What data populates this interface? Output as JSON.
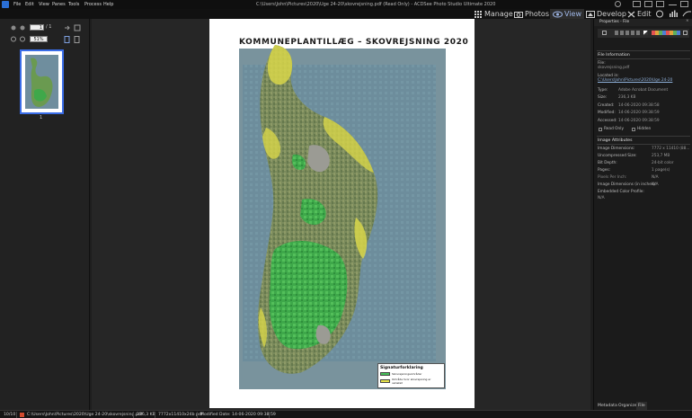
{
  "menubar": {
    "items": [
      "File",
      "Edit",
      "View",
      "Panes",
      "Tools",
      "Process",
      "Help"
    ]
  },
  "window_title": "C:\\Users\\John\\Pictures\\2020\\Uge 24-20\\skovrejsning.pdf (Read Only) - ACDSee Photo Studio Ultimate 2020",
  "modes": [
    "Manage",
    "Photos",
    "View",
    "Develop",
    "Edit"
  ],
  "active_mode": "View",
  "left_toolbar": {
    "page_current": "1",
    "page_total": "/ 1",
    "zoom": "51%"
  },
  "thumbnails": [
    {
      "page_number": "1"
    }
  ],
  "document": {
    "title": "KOMMUNEPLANTILLÆG – SKOVREJSNING 2020",
    "legend_title": "Signaturforklaring",
    "legend_items": [
      {
        "label": "Skovrejsningsområder",
        "color": "#46c15a"
      },
      {
        "label": "Område hvor skovrejsning er uønsket",
        "color": "#e6e24a"
      }
    ]
  },
  "properties_panel": {
    "title": "Properties - File",
    "file_info_heading": "File Information",
    "file_label": "File:",
    "file_value": "skovrejsning.pdf",
    "located_label": "Located in:",
    "located_value": "C:\\Users\\John\\Pictures\\2020\\Uge 24-20",
    "type_label": "Type:",
    "type_value": "Adobe Acrobat Document",
    "size_label": "Size:",
    "size_value": "236,3 KB",
    "created_label": "Created:",
    "created_value": "14-06-2020 09:38:58",
    "modified_label": "Modified:",
    "modified_value": "14-06-2020 09:38:59",
    "accessed_label": "Accessed:",
    "accessed_value": "14-06-2020 09:38:59",
    "readonly_label": "Read Only",
    "hidden_label": "Hidden",
    "image_attr_heading": "Image Attributes",
    "image_dim_label": "Image Dimensions:",
    "image_dim_value": "7772 x 11410 (88...",
    "uncompressed_label": "Uncompressed Size:",
    "uncompressed_value": "253,7 MB",
    "bitdepth_label": "Bit Depth:",
    "bitdepth_value": "24-bit color",
    "pages_label": "Pages:",
    "pages_value": "1 page(s)",
    "ppi_label": "Pixels Per Inch:",
    "ppi_value": "N/A",
    "dim_inches_label": "Image Dimensions (in inches):",
    "dim_inches_value": "N/A",
    "color_profile_label": "Embedded Color Profile:",
    "color_profile_value": "N/A",
    "tabs": [
      "Metadata",
      "Organize",
      "File"
    ],
    "active_tab": "File"
  },
  "statusbar": {
    "count": "10/10",
    "path": "C:\\Users\\John\\Pictures\\2020\\Uge 24-20\\skovrejsning.pdf",
    "size": "236,3 KB",
    "dims": "7772x11410x24b pdf",
    "modified": "Modified Date: 14-06-2020 09:38:59"
  },
  "colors": {
    "accent": "#3a6de8",
    "forest_green": "#46c15a",
    "unwanted_yellow": "#e6e24a"
  }
}
